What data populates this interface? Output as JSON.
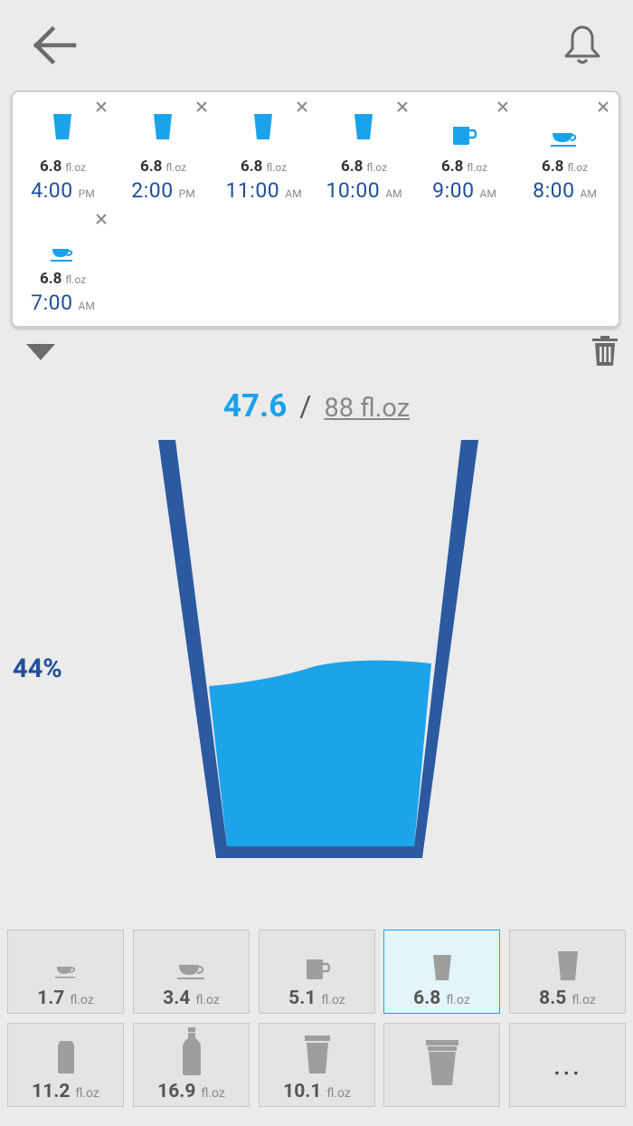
{
  "log": {
    "entries": [
      {
        "icon": "glass-icon",
        "amount": "6.8",
        "unit": "fl.oz",
        "time": "4:00",
        "ampm": "PM"
      },
      {
        "icon": "glass-icon",
        "amount": "6.8",
        "unit": "fl.oz",
        "time": "2:00",
        "ampm": "PM"
      },
      {
        "icon": "glass-icon",
        "amount": "6.8",
        "unit": "fl.oz",
        "time": "11:00",
        "ampm": "AM"
      },
      {
        "icon": "glass-icon",
        "amount": "6.8",
        "unit": "fl.oz",
        "time": "10:00",
        "ampm": "AM"
      },
      {
        "icon": "mug-icon",
        "amount": "6.8",
        "unit": "fl.oz",
        "time": "9:00",
        "ampm": "AM"
      },
      {
        "icon": "teacup-icon",
        "amount": "6.8",
        "unit": "fl.oz",
        "time": "8:00",
        "ampm": "AM"
      },
      {
        "icon": "teacup-icon",
        "amount": "6.8",
        "unit": "fl.oz",
        "time": "7:00",
        "ampm": "AM"
      }
    ]
  },
  "progress": {
    "current": "47.6",
    "separator": "/",
    "goal": "88 fl.oz",
    "percent_label": "44%",
    "fill_fraction": 0.44
  },
  "drinks": {
    "items": [
      {
        "icon": "small-teacup-icon",
        "amount": "1.7",
        "unit": "fl.oz"
      },
      {
        "icon": "teacup-icon",
        "amount": "3.4",
        "unit": "fl.oz"
      },
      {
        "icon": "mug-icon",
        "amount": "5.1",
        "unit": "fl.oz"
      },
      {
        "icon": "glass-icon",
        "amount": "6.8",
        "unit": "fl.oz",
        "selected": true
      },
      {
        "icon": "tall-glass-icon",
        "amount": "8.5",
        "unit": "fl.oz"
      },
      {
        "icon": "can-icon",
        "amount": "11.2",
        "unit": "fl.oz"
      },
      {
        "icon": "bottle-icon",
        "amount": "16.9",
        "unit": "fl.oz"
      },
      {
        "icon": "lidded-cup-icon",
        "amount": "10.1",
        "unit": "fl.oz"
      },
      {
        "icon": "custom-cup-icon",
        "amount": "",
        "unit": ""
      },
      {
        "icon": "more-icon",
        "amount": "...",
        "unit": ""
      }
    ]
  },
  "colors": {
    "accent": "#1ba2ea",
    "water": "#1da3ea",
    "glass": "#2b5aa0",
    "text_dark_blue": "#1e4f9c",
    "background": "#ebebeb"
  }
}
